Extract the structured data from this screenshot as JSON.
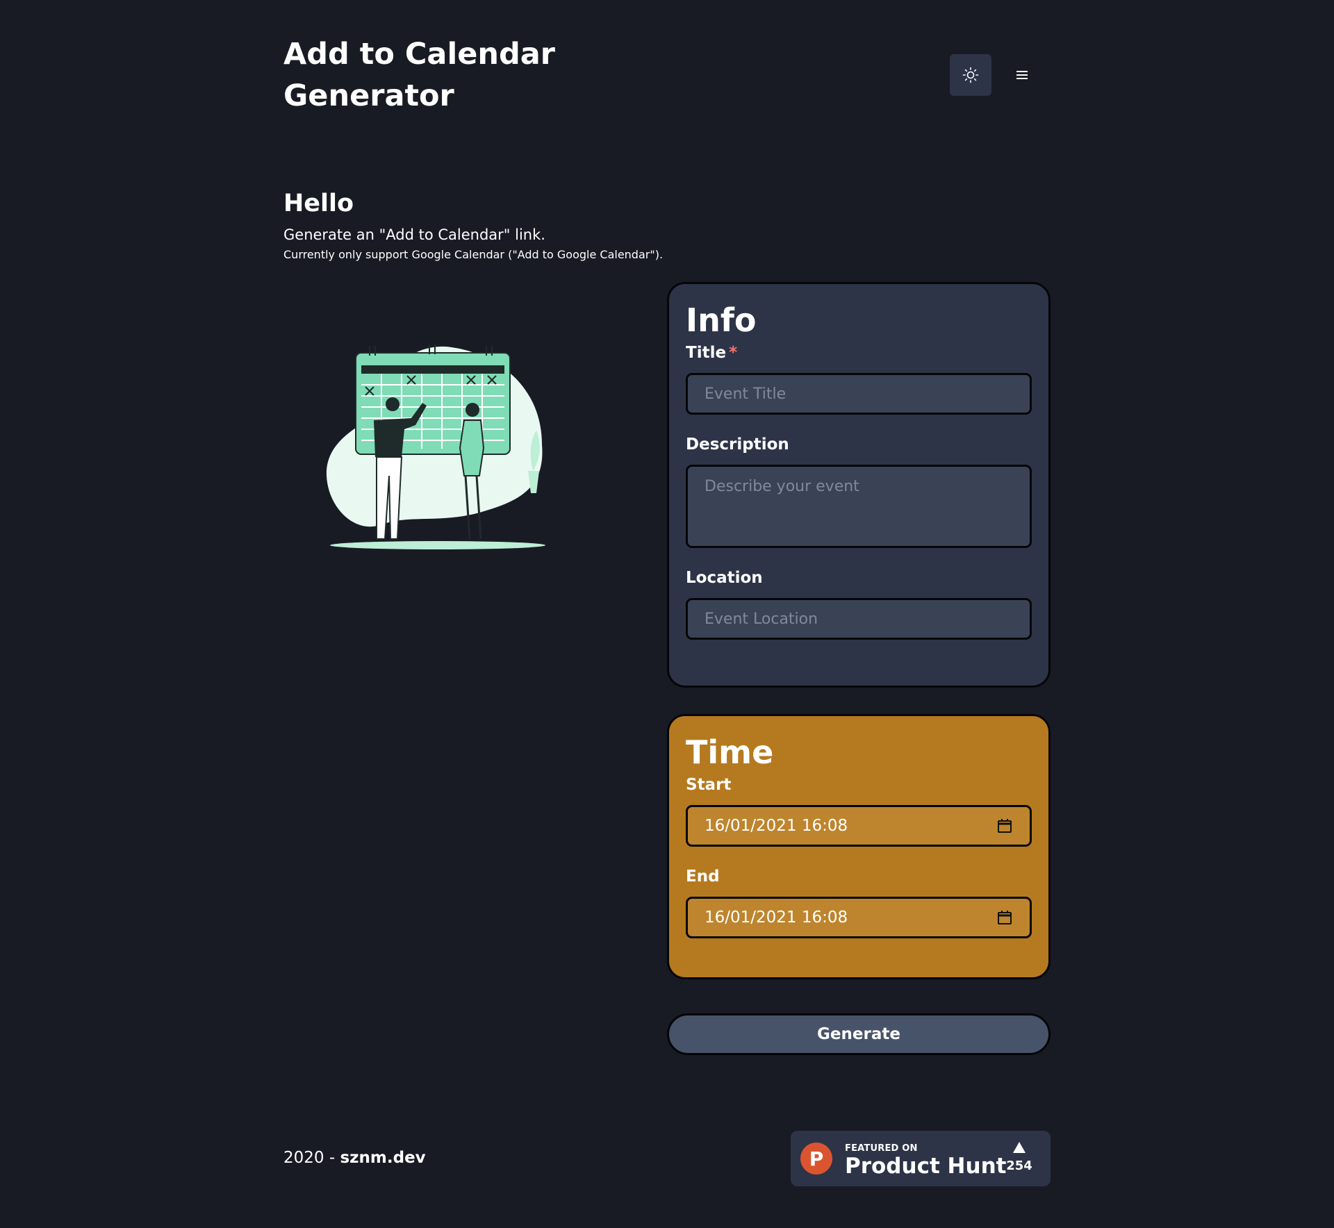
{
  "header": {
    "title": "Add to Calendar Generator",
    "theme_icon": "sun-icon",
    "menu_icon": "hamburger-menu-icon"
  },
  "intro": {
    "heading": "Hello",
    "line1": "Generate an \"Add to Calendar\" link.",
    "line2": "Currently only support Google Calendar (\"Add to Google Calendar\")."
  },
  "info": {
    "heading": "Info",
    "title_label": "Title",
    "title_required": "*",
    "title_placeholder": "Event Title",
    "description_label": "Description",
    "description_placeholder": "Describe your event",
    "location_label": "Location",
    "location_placeholder": "Event Location"
  },
  "time": {
    "heading": "Time",
    "start_label": "Start",
    "start_value": "16/01/2021 16:08",
    "end_label": "End",
    "end_value": "16/01/2021 16:08"
  },
  "actions": {
    "generate_label": "Generate"
  },
  "footer": {
    "year": "2020",
    "separator": " - ",
    "site": "sznm.dev"
  },
  "producthunt": {
    "logo_letter": "P",
    "featured_label": "FEATURED ON",
    "brand": "Product Hunt",
    "votes": "254"
  },
  "colors": {
    "background": "#191b24",
    "info_card": "#2d3447",
    "time_card": "#b57a20",
    "button": "#475368",
    "producthunt_brand": "#da552f",
    "illustration_accent": "#7fdcb6"
  }
}
